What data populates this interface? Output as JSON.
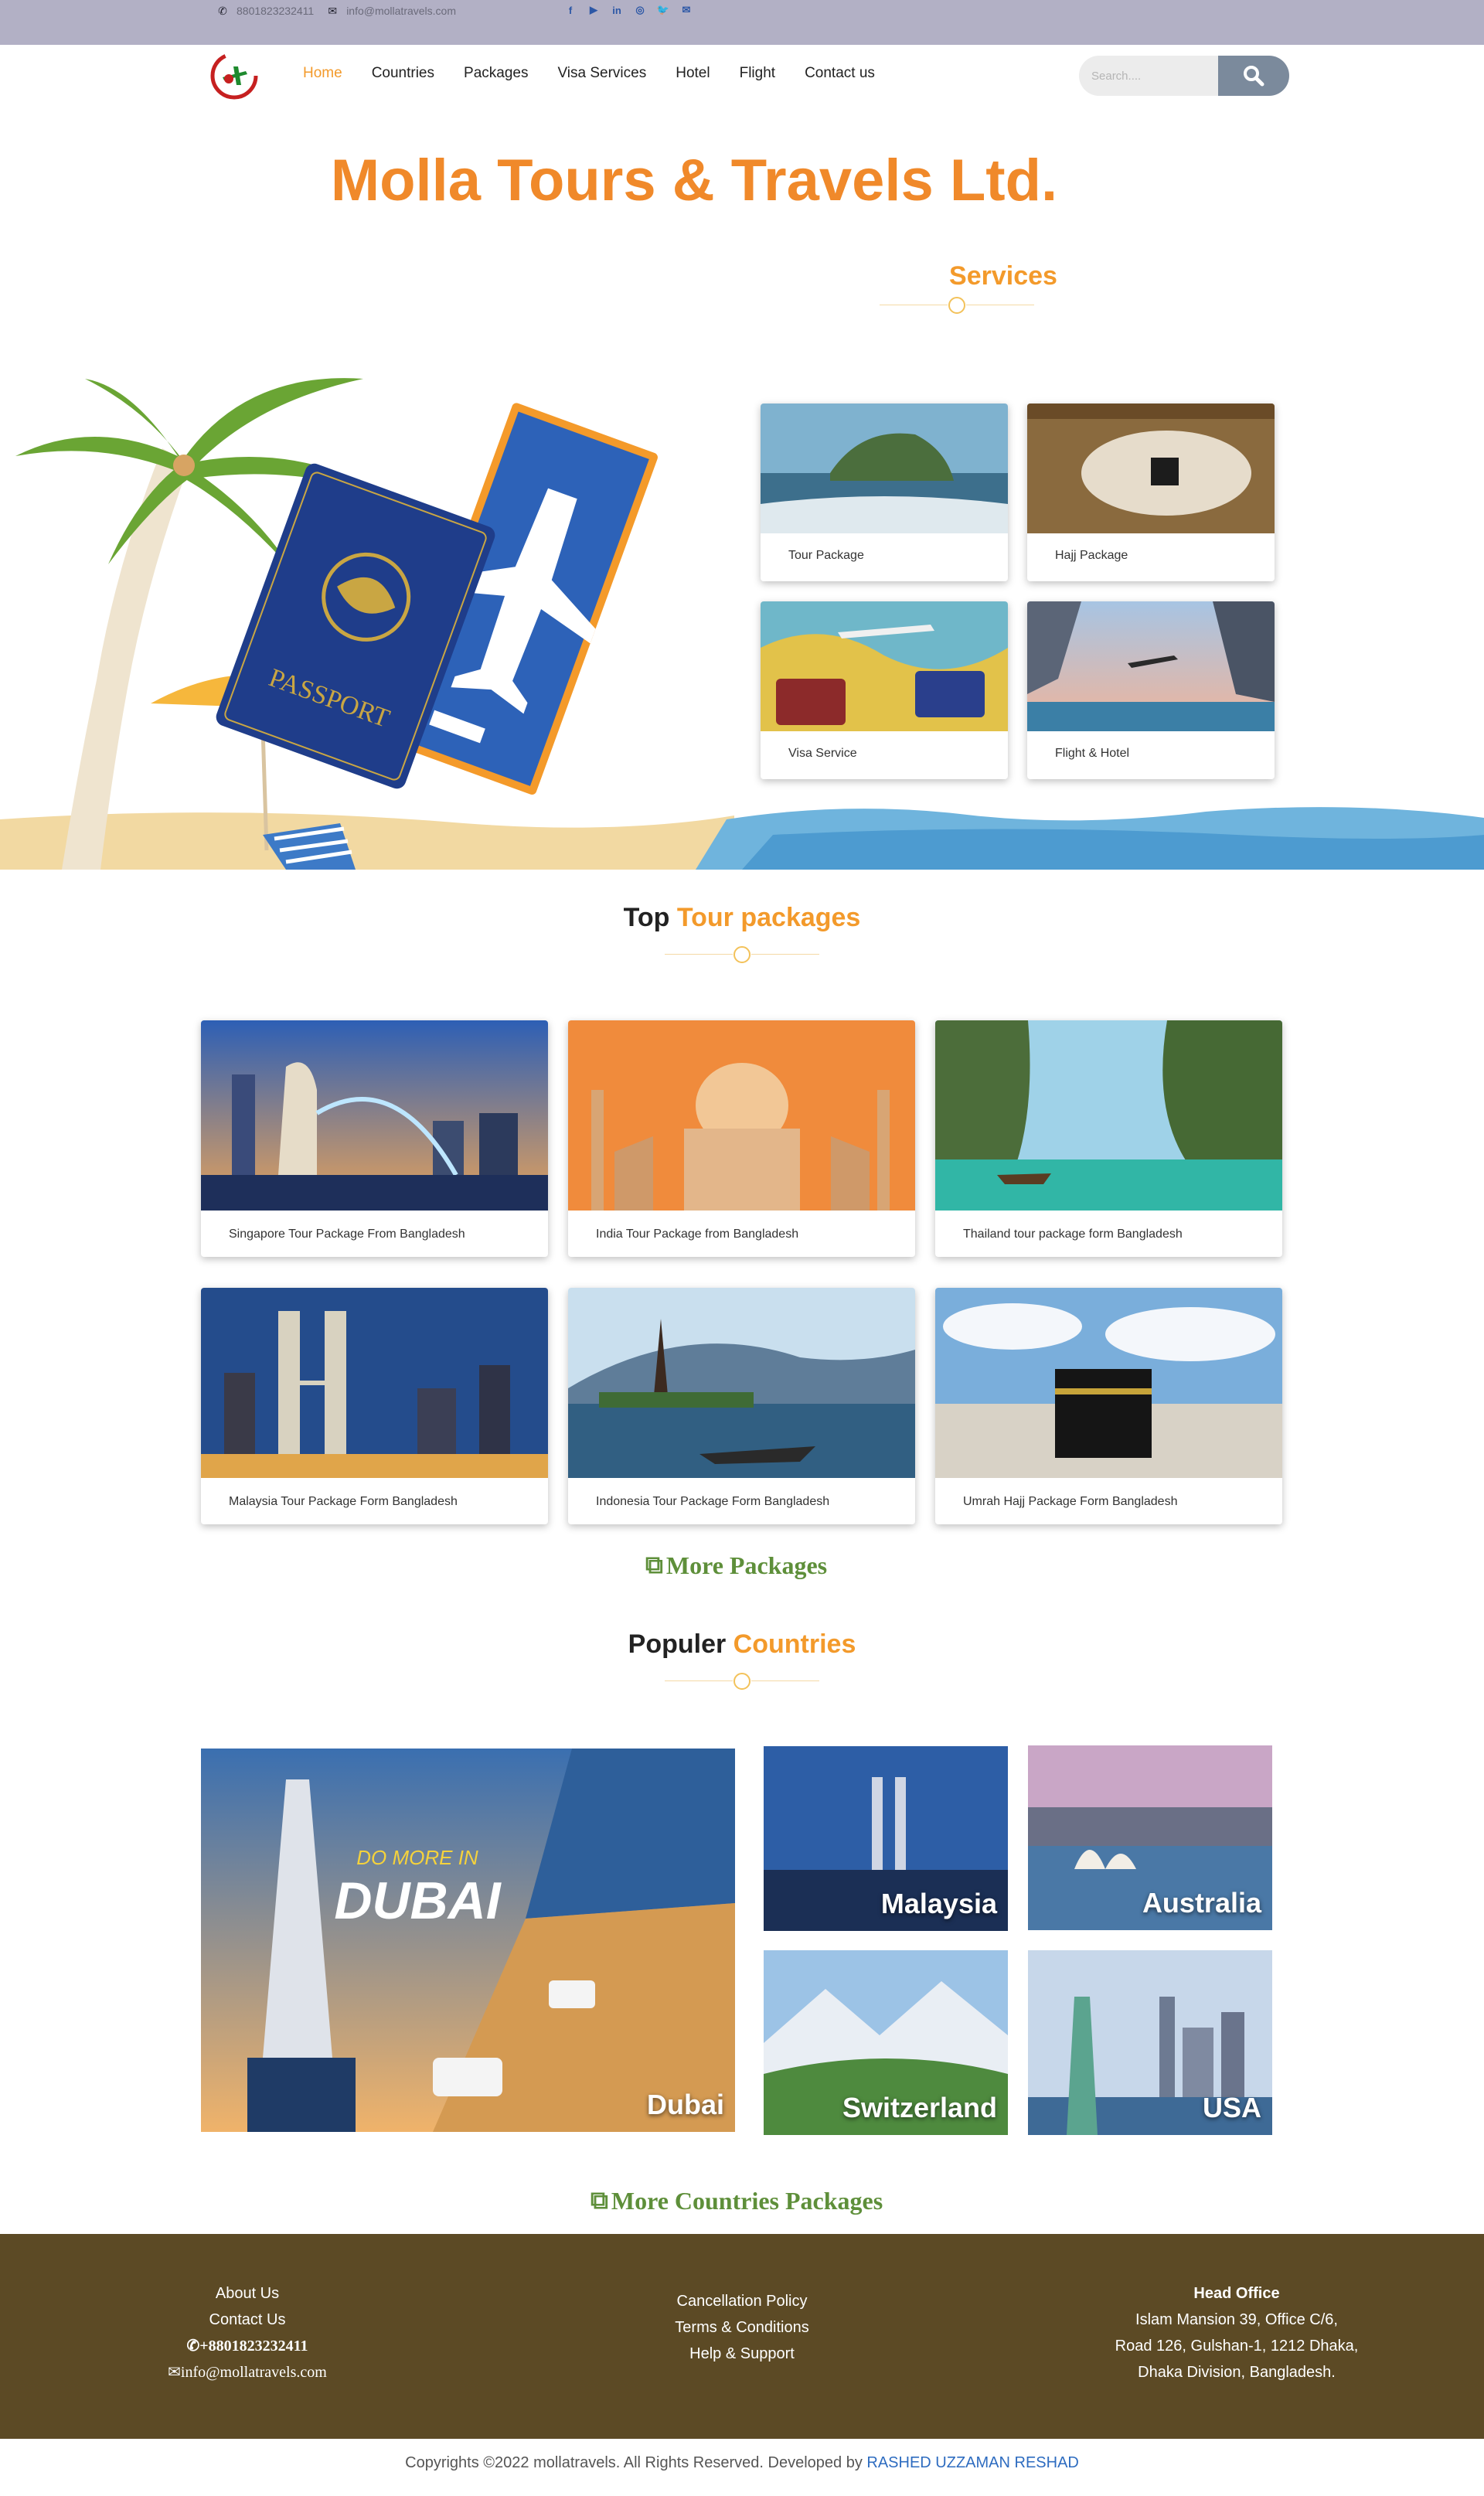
{
  "topbar": {
    "phone": "8801823232411",
    "email": "info@mollatravels.com",
    "social": [
      "facebook-icon",
      "youtube-icon",
      "linkedin-icon",
      "instagram-icon",
      "twitter-icon",
      "mail-icon"
    ]
  },
  "nav": {
    "items": [
      "Home",
      "Countries",
      "Packages",
      "Visa Services",
      "Hotel",
      "Flight",
      "Contact us"
    ],
    "search_placeholder": "Search...."
  },
  "hero": {
    "title": "Molla Tours & Travels Ltd."
  },
  "services": {
    "title": "Services",
    "cards": [
      "Tour Package",
      "Hajj Package",
      "Visa Service",
      "Flight & Hotel"
    ]
  },
  "packages": {
    "title_a": "Top",
    "title_b": "Tour packages",
    "cards": [
      "Singapore Tour Package From Bangladesh",
      "India Tour Package from Bangladesh",
      "Thailand tour package form Bangladesh",
      "Malaysia Tour Package Form Bangladesh",
      "Indonesia Tour Package Form Bangladesh",
      "Umrah Hajj Package Form Bangladesh"
    ],
    "more": "More Packages"
  },
  "countries": {
    "title_a": "Populer",
    "title_b": "Countries",
    "items": [
      "Dubai",
      "Malaysia",
      "Australia",
      "Switzerland",
      "USA"
    ],
    "dubai_promo_1": "DO MORE IN",
    "dubai_promo_2": "DUBAI",
    "more": "More Countries Packages"
  },
  "footer": {
    "col1": [
      "About Us",
      "Contact Us",
      "+8801823232411",
      "info@mollatravels.com"
    ],
    "col2": [
      "Cancellation Policy",
      "Terms & Conditions",
      "Help & Support"
    ],
    "col3_title": "Head Office",
    "col3": [
      "Islam Mansion 39, Office C/6,",
      "Road 126, Gulshan-1, 1212 Dhaka,",
      "Dhaka Division, Bangladesh."
    ],
    "copyright": "Copyrights ©2022 mollatravels. All Rights Reserved. Developed by",
    "developer": "RASHED UZZAMAN RESHAD"
  },
  "colors": {
    "accent": "#f39a2b",
    "footer": "#5c4a25",
    "link_green": "#5e8f3a"
  }
}
